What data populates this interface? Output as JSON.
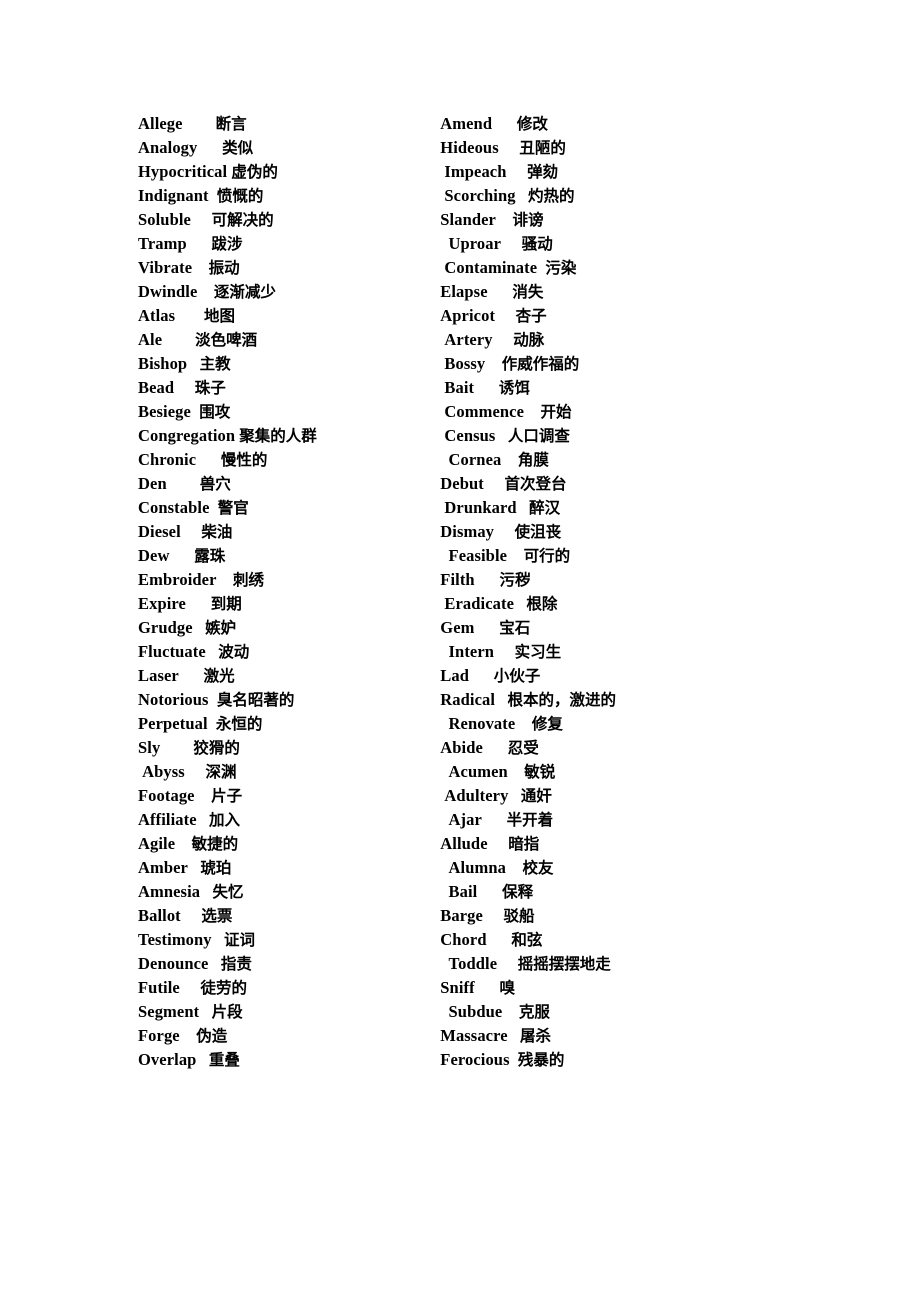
{
  "document": {
    "kind": "vocabulary-list",
    "columns": 2,
    "row_count": 40,
    "background_color": "#ffffff",
    "text_color": "#000000"
  },
  "rows": [
    {
      "left": {
        "term": "Allege",
        "indent": 0,
        "gap": 8,
        "gloss": "断言"
      },
      "right": {
        "term": "Amend",
        "indent": 0,
        "gap": 6,
        "gloss": "修改"
      }
    },
    {
      "left": {
        "term": "Analogy",
        "indent": 0,
        "gap": 6,
        "gloss": "类似"
      },
      "right": {
        "term": "Hideous",
        "indent": 0,
        "gap": 5,
        "gloss": "丑陋的"
      }
    },
    {
      "left": {
        "term": "Hypocritical",
        "indent": 0,
        "gap": 1,
        "gloss": "虚伪的"
      },
      "right": {
        "term": "Impeach",
        "indent": 1,
        "gap": 5,
        "gloss": "弹劾"
      }
    },
    {
      "left": {
        "term": "Indignant",
        "indent": 0,
        "gap": 2,
        "gloss": "愤慨的"
      },
      "right": {
        "term": "Scorching",
        "indent": 1,
        "gap": 3,
        "gloss": "灼热的"
      }
    },
    {
      "left": {
        "term": "Soluble",
        "indent": 0,
        "gap": 5,
        "gloss": "可解决的"
      },
      "right": {
        "term": "Slander",
        "indent": 0,
        "gap": 4,
        "gloss": "诽谤"
      }
    },
    {
      "left": {
        "term": "Tramp",
        "indent": 0,
        "gap": 6,
        "gloss": "跋涉"
      },
      "right": {
        "term": "Uproar",
        "indent": 2,
        "gap": 5,
        "gloss": "骚动"
      }
    },
    {
      "left": {
        "term": "Vibrate",
        "indent": 0,
        "gap": 4,
        "gloss": "振动"
      },
      "right": {
        "term": "Contaminate",
        "indent": 1,
        "gap": 2,
        "gloss": "污染"
      }
    },
    {
      "left": {
        "term": "Dwindle",
        "indent": 0,
        "gap": 4,
        "gloss": "逐渐减少"
      },
      "right": {
        "term": "Elapse",
        "indent": 0,
        "gap": 6,
        "gloss": "消失"
      }
    },
    {
      "left": {
        "term": "Atlas",
        "indent": 0,
        "gap": 7,
        "gloss": "地图"
      },
      "right": {
        "term": "Apricot",
        "indent": 0,
        "gap": 5,
        "gloss": "杏子"
      }
    },
    {
      "left": {
        "term": "Ale",
        "indent": 0,
        "gap": 8,
        "gloss": "淡色啤酒"
      },
      "right": {
        "term": "Artery",
        "indent": 1,
        "gap": 5,
        "gloss": "动脉"
      }
    },
    {
      "left": {
        "term": "Bishop",
        "indent": 0,
        "gap": 3,
        "gloss": "主教"
      },
      "right": {
        "term": "Bossy",
        "indent": 1,
        "gap": 4,
        "gloss": "作威作福的"
      }
    },
    {
      "left": {
        "term": "Bead",
        "indent": 0,
        "gap": 5,
        "gloss": "珠子"
      },
      "right": {
        "term": "Bait",
        "indent": 1,
        "gap": 6,
        "gloss": "诱饵"
      }
    },
    {
      "left": {
        "term": "Besiege",
        "indent": 0,
        "gap": 2,
        "gloss": "围攻"
      },
      "right": {
        "term": "Commence",
        "indent": 1,
        "gap": 4,
        "gloss": "开始"
      }
    },
    {
      "left": {
        "term": "Congregation",
        "indent": 0,
        "gap": 1,
        "gloss": "聚集的人群"
      },
      "right": {
        "term": "Census",
        "indent": 1,
        "gap": 3,
        "gloss": "人口调查"
      }
    },
    {
      "left": {
        "term": "Chronic",
        "indent": 0,
        "gap": 6,
        "gloss": "慢性的"
      },
      "right": {
        "term": "Cornea",
        "indent": 2,
        "gap": 4,
        "gloss": "角膜"
      }
    },
    {
      "left": {
        "term": "Den",
        "indent": 0,
        "gap": 8,
        "gloss": "兽穴"
      },
      "right": {
        "term": "Debut",
        "indent": 0,
        "gap": 5,
        "gloss": "首次登台"
      }
    },
    {
      "left": {
        "term": "Constable",
        "indent": 0,
        "gap": 2,
        "gloss": "警官"
      },
      "right": {
        "term": "Drunkard",
        "indent": 1,
        "gap": 3,
        "gloss": "醉汉"
      }
    },
    {
      "left": {
        "term": "Diesel",
        "indent": 0,
        "gap": 5,
        "gloss": "柴油"
      },
      "right": {
        "term": "Dismay",
        "indent": 0,
        "gap": 5,
        "gloss": "使沮丧"
      }
    },
    {
      "left": {
        "term": "Dew",
        "indent": 0,
        "gap": 6,
        "gloss": "露珠"
      },
      "right": {
        "term": "Feasible",
        "indent": 2,
        "gap": 4,
        "gloss": "可行的"
      }
    },
    {
      "left": {
        "term": "Embroider",
        "indent": 0,
        "gap": 4,
        "gloss": "刺绣"
      },
      "right": {
        "term": "Filth",
        "indent": 0,
        "gap": 6,
        "gloss": "污秽"
      }
    },
    {
      "left": {
        "term": "Expire",
        "indent": 0,
        "gap": 6,
        "gloss": "到期"
      },
      "right": {
        "term": "Eradicate",
        "indent": 1,
        "gap": 3,
        "gloss": "根除"
      }
    },
    {
      "left": {
        "term": "Grudge",
        "indent": 0,
        "gap": 3,
        "gloss": "嫉妒"
      },
      "right": {
        "term": "Gem",
        "indent": 0,
        "gap": 6,
        "gloss": "宝石"
      }
    },
    {
      "left": {
        "term": "Fluctuate",
        "indent": 0,
        "gap": 3,
        "gloss": "波动"
      },
      "right": {
        "term": "Intern",
        "indent": 2,
        "gap": 5,
        "gloss": "实习生"
      }
    },
    {
      "left": {
        "term": "Laser",
        "indent": 0,
        "gap": 6,
        "gloss": "激光"
      },
      "right": {
        "term": "Lad",
        "indent": 0,
        "gap": 6,
        "gloss": "小伙子"
      }
    },
    {
      "left": {
        "term": "Notorious",
        "indent": 0,
        "gap": 2,
        "gloss": "臭名昭著的"
      },
      "right": {
        "term": "Radical",
        "indent": 0,
        "gap": 3,
        "gloss": "根本的，激进的"
      }
    },
    {
      "left": {
        "term": "Perpetual",
        "indent": 0,
        "gap": 2,
        "gloss": "永恒的"
      },
      "right": {
        "term": "Renovate",
        "indent": 2,
        "gap": 4,
        "gloss": "修复"
      }
    },
    {
      "left": {
        "term": "Sly",
        "indent": 0,
        "gap": 8,
        "gloss": "狡猾的"
      },
      "right": {
        "term": "Abide",
        "indent": 0,
        "gap": 6,
        "gloss": "忍受"
      }
    },
    {
      "left": {
        "term": "Abyss",
        "indent": 1,
        "gap": 5,
        "gloss": "深渊"
      },
      "right": {
        "term": "Acumen",
        "indent": 2,
        "gap": 4,
        "gloss": "敏锐"
      }
    },
    {
      "left": {
        "term": "Footage",
        "indent": 0,
        "gap": 4,
        "gloss": "片子"
      },
      "right": {
        "term": "Adultery",
        "indent": 1,
        "gap": 3,
        "gloss": "通奸"
      }
    },
    {
      "left": {
        "term": "Affiliate",
        "indent": 0,
        "gap": 3,
        "gloss": "加入"
      },
      "right": {
        "term": "Ajar",
        "indent": 2,
        "gap": 6,
        "gloss": "半开着"
      }
    },
    {
      "left": {
        "term": "Agile",
        "indent": 0,
        "gap": 4,
        "gloss": "敏捷的"
      },
      "right": {
        "term": "Allude",
        "indent": 0,
        "gap": 5,
        "gloss": "暗指"
      }
    },
    {
      "left": {
        "term": "Amber",
        "indent": 0,
        "gap": 3,
        "gloss": "琥珀"
      },
      "right": {
        "term": "Alumna",
        "indent": 2,
        "gap": 4,
        "gloss": "校友"
      }
    },
    {
      "left": {
        "term": "Amnesia",
        "indent": 0,
        "gap": 3,
        "gloss": "失忆"
      },
      "right": {
        "term": "Bail",
        "indent": 2,
        "gap": 6,
        "gloss": "保释"
      }
    },
    {
      "left": {
        "term": "Ballot",
        "indent": 0,
        "gap": 5,
        "gloss": "选票"
      },
      "right": {
        "term": "Barge",
        "indent": 0,
        "gap": 5,
        "gloss": "驳船"
      }
    },
    {
      "left": {
        "term": "Testimony",
        "indent": 0,
        "gap": 3,
        "gloss": "证词"
      },
      "right": {
        "term": "Chord",
        "indent": 0,
        "gap": 6,
        "gloss": "和弦"
      }
    },
    {
      "left": {
        "term": "Denounce",
        "indent": 0,
        "gap": 3,
        "gloss": "指责"
      },
      "right": {
        "term": "Toddle",
        "indent": 2,
        "gap": 5,
        "gloss": "摇摇摆摆地走"
      }
    },
    {
      "left": {
        "term": "Futile",
        "indent": 0,
        "gap": 5,
        "gloss": "徒劳的"
      },
      "right": {
        "term": "Sniff",
        "indent": 0,
        "gap": 6,
        "gloss": "嗅"
      }
    },
    {
      "left": {
        "term": "Segment",
        "indent": 0,
        "gap": 3,
        "gloss": "片段"
      },
      "right": {
        "term": "Subdue",
        "indent": 2,
        "gap": 4,
        "gloss": "克服"
      }
    },
    {
      "left": {
        "term": "Forge",
        "indent": 0,
        "gap": 4,
        "gloss": "伪造"
      },
      "right": {
        "term": "Massacre",
        "indent": 0,
        "gap": 3,
        "gloss": "屠杀"
      }
    },
    {
      "left": {
        "term": "Overlap",
        "indent": 0,
        "gap": 3,
        "gloss": "重叠"
      },
      "right": {
        "term": "Ferocious",
        "indent": 0,
        "gap": 2,
        "gloss": "残暴的"
      }
    }
  ]
}
